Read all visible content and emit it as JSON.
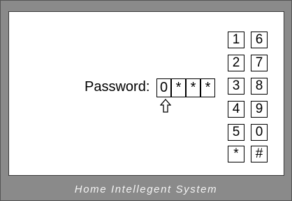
{
  "footer_text": "Home Intellegent System",
  "password": {
    "label": "Password:",
    "slots": [
      "0",
      "*",
      "*",
      "*"
    ]
  },
  "cursor_icon": "up-arrow-icon",
  "keypad": {
    "left_column": [
      "1",
      "2",
      "3",
      "4",
      "5",
      "*"
    ],
    "right_column": [
      "6",
      "7",
      "8",
      "9",
      "0",
      "#"
    ]
  },
  "colors": {
    "frame": "#8a8a8a",
    "screen": "#ffffff"
  }
}
